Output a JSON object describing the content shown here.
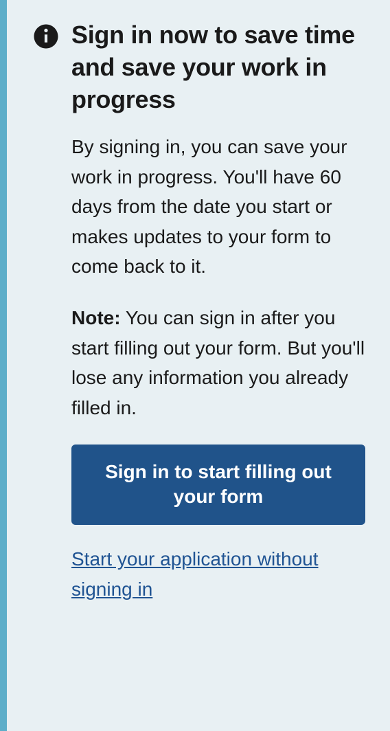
{
  "alert": {
    "title": "Sign in now to save time and save your work in progress",
    "body_paragraph": "By signing in, you can save your work in progress. You'll have 60 days from the date you start or makes updates to your form to come back to it.",
    "note_label": "Note:",
    "note_text": " You can sign in after you start filling out your form. But you'll lose any information you already filled in.",
    "primary_button": "Sign in to start filling out your form",
    "secondary_link": "Start your application without signing in"
  }
}
